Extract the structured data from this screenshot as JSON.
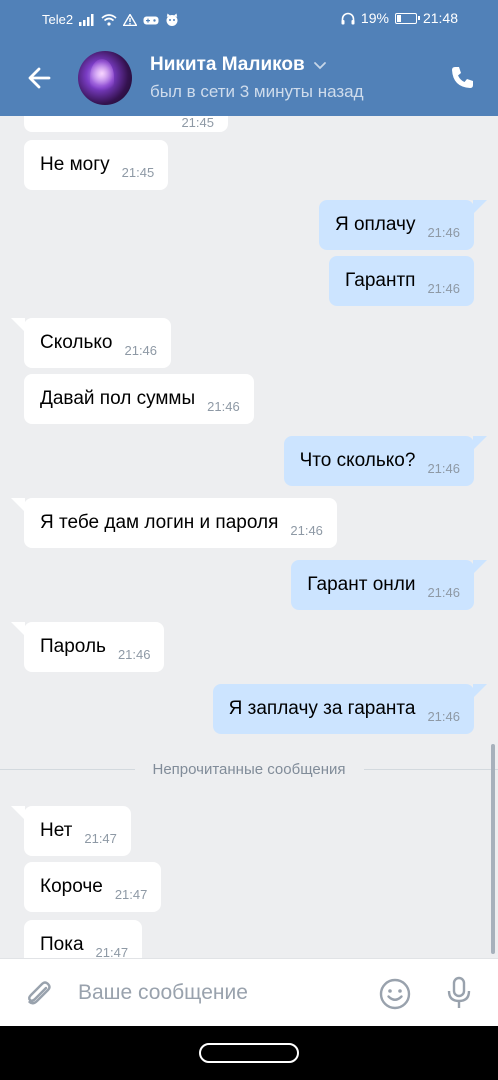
{
  "status_bar": {
    "carrier": "Tele2",
    "battery": "19%",
    "battery_level": 0.19,
    "time": "21:48",
    "icons": [
      "signal-icon",
      "wifi-icon",
      "warning-icon",
      "game-icon",
      "cat-icon",
      "headphones-icon",
      "battery-icon"
    ]
  },
  "header": {
    "name": "Никита Маликов",
    "last_seen": "был в сети 3 минуты назад",
    "icons": [
      "back-arrow-icon",
      "chevron-down-icon",
      "phone-icon"
    ]
  },
  "chat": {
    "top_partial_time": "21:45",
    "messages": [
      {
        "dir": "in",
        "text": "Не могу",
        "time": "21:45"
      },
      {
        "dir": "out",
        "text": "Я оплачу",
        "time": "21:46"
      },
      {
        "dir": "out",
        "text": "Гарантп",
        "time": "21:46"
      },
      {
        "dir": "in",
        "text": "Сколько",
        "time": "21:46"
      },
      {
        "dir": "in",
        "text": "Давай пол суммы",
        "time": "21:46"
      },
      {
        "dir": "out",
        "text": "Что сколько?",
        "time": "21:46"
      },
      {
        "dir": "in",
        "text": "Я тебе дам логин и пароля",
        "time": "21:46"
      },
      {
        "dir": "out",
        "text": "Гарант онли",
        "time": "21:46"
      },
      {
        "dir": "in",
        "text": "Пароль",
        "time": "21:46"
      },
      {
        "dir": "out",
        "text": "Я заплачу за гаранта",
        "time": "21:46"
      },
      {
        "dir": "in",
        "text": "Нет",
        "time": "21:47"
      },
      {
        "dir": "in",
        "text": "Короче",
        "time": "21:47"
      },
      {
        "dir": "in",
        "text": "Пока",
        "time": "21:47"
      }
    ],
    "unread_label": "Непрочитанные сообщения"
  },
  "composer": {
    "placeholder": "Ваше сообщение",
    "value": "",
    "icons": [
      "paperclip-icon",
      "emoji-icon",
      "microphone-icon"
    ]
  },
  "colors": {
    "header_bg": "#5181b8",
    "chat_bg": "#edeef0",
    "bubble_in": "#ffffff",
    "bubble_out": "#cce4ff",
    "time_text": "#8e99a5"
  }
}
